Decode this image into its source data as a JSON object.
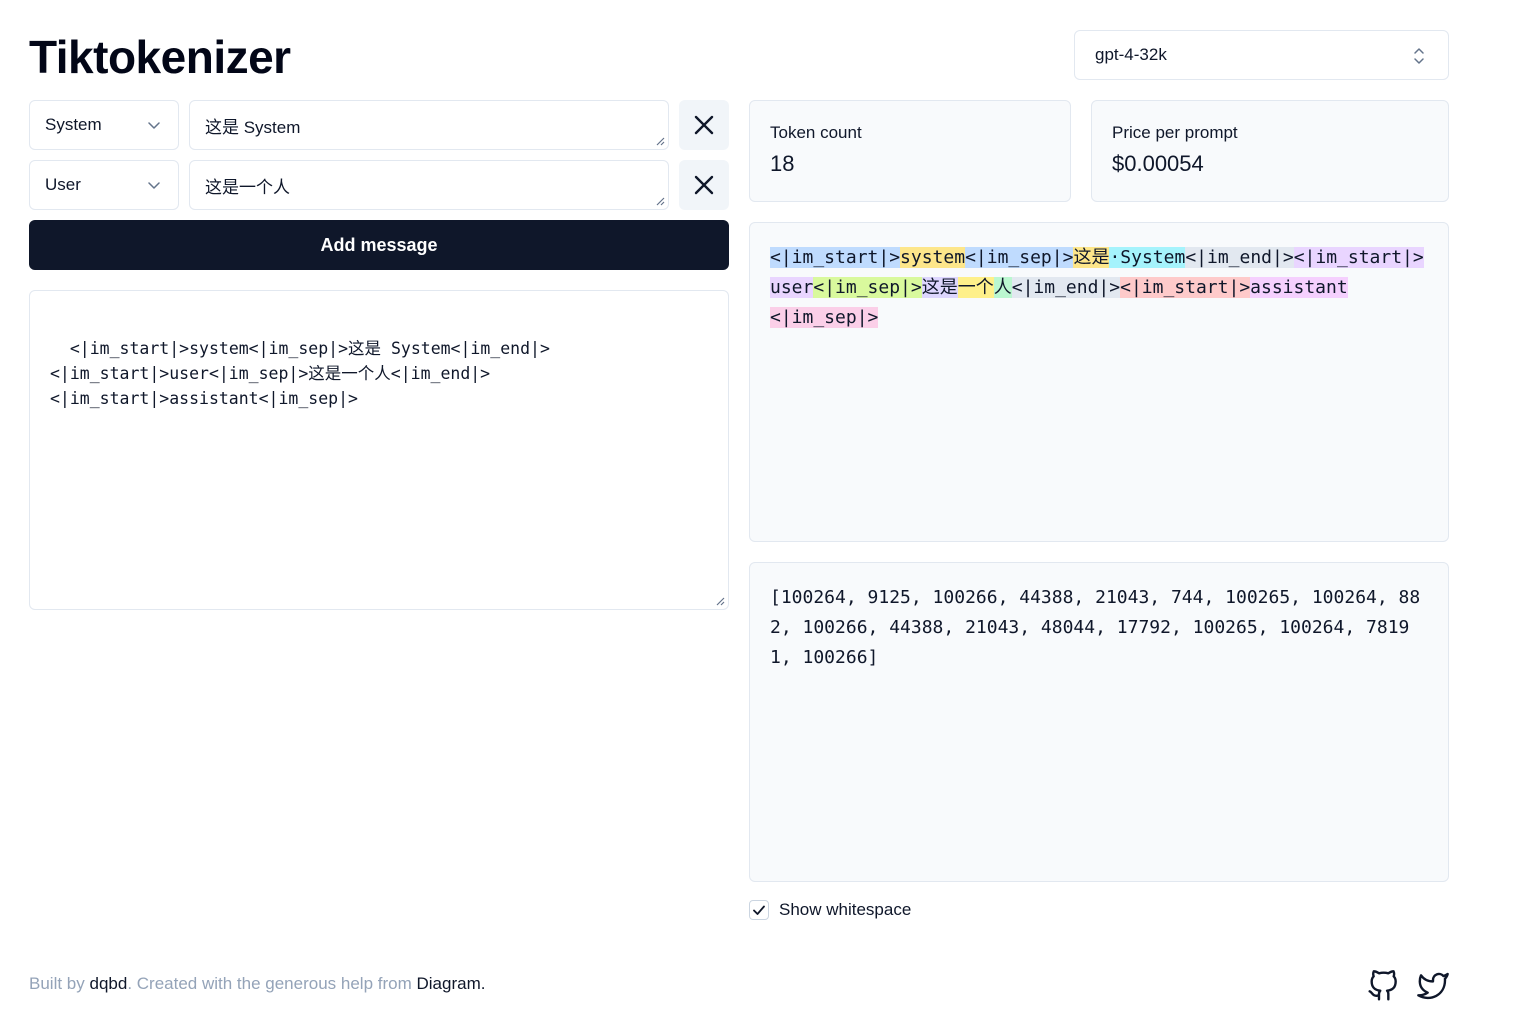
{
  "header": {
    "title": "Tiktokenizer"
  },
  "model_select": {
    "value": "gpt-4-32k"
  },
  "messages": [
    {
      "role": "System",
      "content": "这是 System"
    },
    {
      "role": "User",
      "content": "这是一个人"
    }
  ],
  "add_button": {
    "label": "Add message"
  },
  "raw_prompt": "<|im_start|>system<|im_sep|>这是 System<|im_end|>\n<|im_start|>user<|im_sep|>这是一个人<|im_end|>\n<|im_start|>assistant<|im_sep|>",
  "stats": {
    "token_count_label": "Token count",
    "token_count_value": "18",
    "price_label": "Price per prompt",
    "price_value": "$0.00054"
  },
  "tokens": [
    {
      "text": "<|im_start|>",
      "color": "#bfdbfe"
    },
    {
      "text": "system",
      "color": "#fde68a"
    },
    {
      "text": "<|im_sep|>",
      "color": "#bfdbfe"
    },
    {
      "text": "这是",
      "color": "#fde68a"
    },
    {
      "text": "·System",
      "color": "#a5f3fc"
    },
    {
      "text": "<|im_end|>",
      "color": "#e2e8f0"
    },
    {
      "text": "<|im_start|>",
      "color": "#e9d5ff"
    },
    {
      "text": "user",
      "color": "#e9d5ff"
    },
    {
      "text": "<|im_sep|>",
      "color": "#d9f99d"
    },
    {
      "text": "这是",
      "color": "#ddd6fe"
    },
    {
      "text": "一个",
      "color": "#fef08a"
    },
    {
      "text": "人",
      "color": "#bbf7d0"
    },
    {
      "text": "<|im_end|>",
      "color": "#e2e8f0"
    },
    {
      "text": "<|im_start|>",
      "color": "#fecaca"
    },
    {
      "text": "assistant",
      "color": "#f5d0fe"
    },
    {
      "text": "<|im_sep|>",
      "color": "#fbcfe8"
    }
  ],
  "token_ids": "[100264, 9125, 100266, 44388, 21043, 744, 100265, 100264, 882, 100266, 44388, 21043, 48044, 17792, 100265, 100264, 78191, 100266]",
  "show_whitespace": {
    "label": "Show whitespace",
    "checked": true
  },
  "footer": {
    "built_by": "Built by",
    "author": "dqbd",
    "created_with": ". Created with the generous help from",
    "helper": "Diagram",
    "end": "."
  }
}
